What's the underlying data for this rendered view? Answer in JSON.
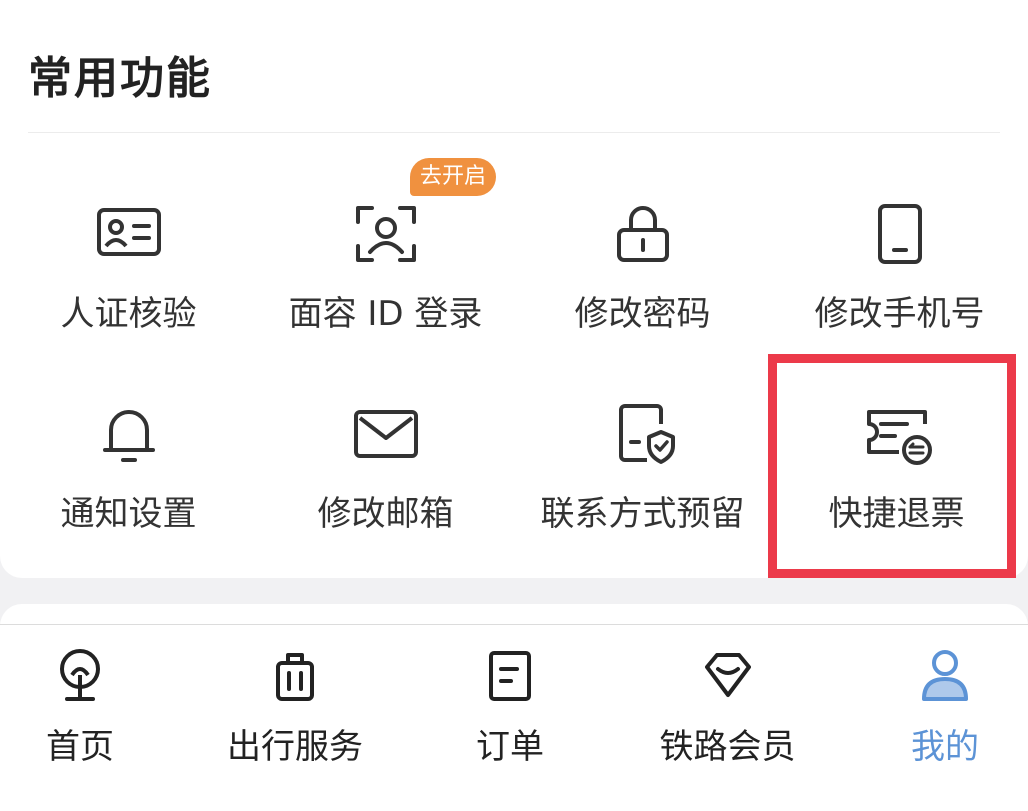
{
  "section": {
    "title": "常用功能"
  },
  "features": [
    {
      "label": "人证核验",
      "icon": "id-card-icon"
    },
    {
      "label": "面容 ID 登录",
      "icon": "face-id-icon",
      "badge": "去开启"
    },
    {
      "label": "修改密码",
      "icon": "lock-icon"
    },
    {
      "label": "修改手机号",
      "icon": "phone-icon"
    },
    {
      "label": "通知设置",
      "icon": "bell-icon"
    },
    {
      "label": "修改邮箱",
      "icon": "mail-icon"
    },
    {
      "label": "联系方式预留",
      "icon": "contact-shield-icon"
    },
    {
      "label": "快捷退票",
      "icon": "ticket-refund-icon"
    }
  ],
  "tabs": [
    {
      "label": "首页",
      "icon": "railway-logo-icon"
    },
    {
      "label": "出行服务",
      "icon": "luggage-icon"
    },
    {
      "label": "订单",
      "icon": "order-doc-icon"
    },
    {
      "label": "铁路会员",
      "icon": "diamond-icon"
    },
    {
      "label": "我的",
      "icon": "user-icon",
      "active": true
    }
  ],
  "colors": {
    "accent": "#5c93d6",
    "badge": "#f0913f",
    "highlight": "#ec3a4a",
    "icon_stroke": "#333333"
  }
}
